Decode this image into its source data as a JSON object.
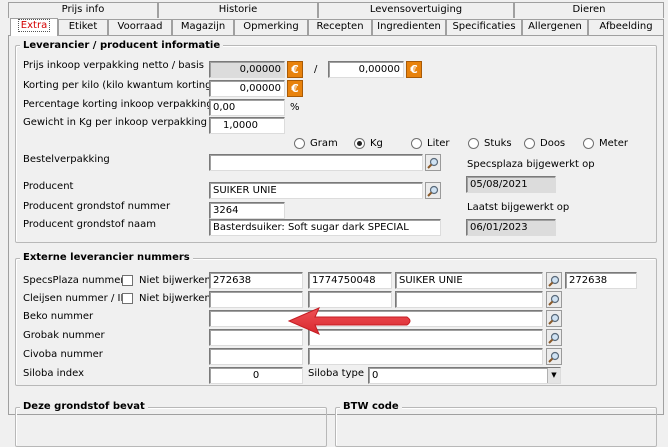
{
  "tabs_row1": [
    {
      "label": "Prijs info"
    },
    {
      "label": "Historie"
    },
    {
      "label": "Levensovertuiging"
    },
    {
      "label": "Dieren"
    }
  ],
  "tabs_row2": [
    {
      "label": "Extra",
      "active": true
    },
    {
      "label": "Etiket"
    },
    {
      "label": "Voorraad"
    },
    {
      "label": "Magazijn"
    },
    {
      "label": "Opmerking"
    },
    {
      "label": "Recepten"
    },
    {
      "label": "Ingredienten"
    },
    {
      "label": "Specificaties"
    },
    {
      "label": "Allergenen"
    },
    {
      "label": "Afbeelding"
    }
  ],
  "leverancier": {
    "title": "Leverancier / producent informatie",
    "price_label": "Prijs inkoop verpakking  netto / basis",
    "price_value": "0,00000",
    "price_separator": "/",
    "price_basis_value": "0,00000",
    "discount_kilo_label": "Korting per kilo (kilo kwantum korting)",
    "discount_kilo_value": "0,00000",
    "discount_pct_label": "Percentage korting inkoop verpakking",
    "discount_pct_value": "0,00",
    "pct_symbol": "%",
    "weight_label": "Gewicht in Kg per inkoop verpakking",
    "weight_value": "1,0000",
    "units": [
      {
        "label": "Gram",
        "selected": false
      },
      {
        "label": "Kg",
        "selected": true
      },
      {
        "label": "Liter",
        "selected": false
      },
      {
        "label": "Stuks",
        "selected": false
      },
      {
        "label": "Doos",
        "selected": false
      },
      {
        "label": "Meter",
        "selected": false
      }
    ],
    "packaging_label": "Bestelverpakking",
    "packaging_value": "",
    "specsplaza_updated_label": "Specsplaza bijgewerkt op",
    "specsplaza_updated_value": "05/08/2021",
    "producer_label": "Producent",
    "producer_value": "SUIKER UNIE",
    "raw_number_label": "Producent grondstof nummer",
    "raw_number_value": "3264",
    "raw_name_label": "Producent grondstof naam",
    "raw_name_value": "Basterdsuiker: Soft sugar dark SPECIAL",
    "last_updated_label": "Laatst bijgewerkt op",
    "last_updated_value": "06/01/2023"
  },
  "extern": {
    "title": "Externe leverancier nummers",
    "specsplaza_label": "SpecsPlaza nummer",
    "no_update_label": "Niet bijwerken!",
    "specsplaza_no_update_label": "Niet bijwerken!",
    "cleijsen_no_update_label": "Niet bijwerken!",
    "specsplaza_value1": "272638",
    "specsplaza_value2": "1774750048",
    "specsplaza_value3": "SUIKER UNIE",
    "specsplaza_value4": "272638",
    "cleijsen_label": "Cleijsen nummer / ID",
    "beko_label": "Beko nummer",
    "grobak_label": "Grobak nummer",
    "civoba_label": "Civoba nummer",
    "siloba_index_label": "Siloba index",
    "siloba_index_value": "0",
    "siloba_type_label": "Siloba type",
    "siloba_type_value": "0"
  },
  "bottom": {
    "left_title": "Deze grondstof bevat",
    "right_title": "BTW code"
  },
  "colors": {
    "active_tab_text": "#d40000",
    "arrow": "#e23a3f",
    "euro_button": "#e8820c"
  }
}
